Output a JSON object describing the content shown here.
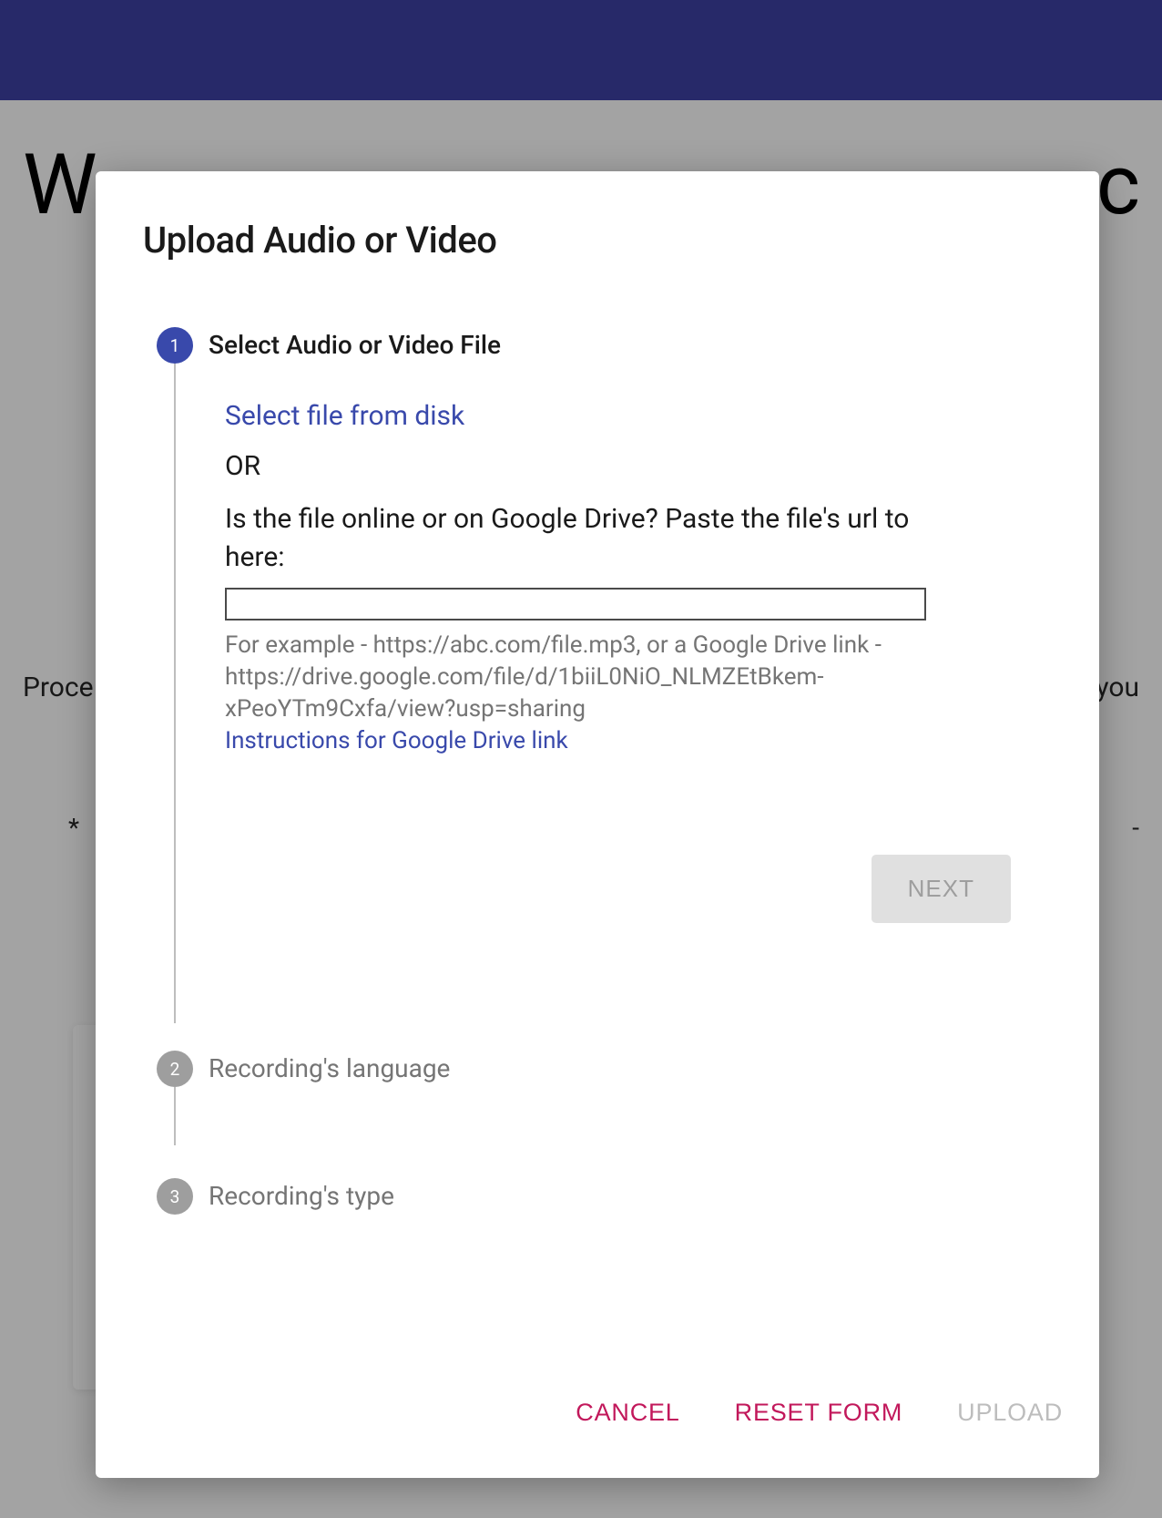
{
  "background": {
    "heading_left": "W",
    "heading_right": "c",
    "text1_left": "Proce",
    "text1_right": "you",
    "text2_left": "*",
    "text2_right": "-"
  },
  "dialog": {
    "title": "Upload Audio or Video",
    "steps": {
      "step1": {
        "number": "1",
        "label": "Select Audio or Video File",
        "select_file_link": "Select file from disk",
        "or_text": "OR",
        "paste_label": "Is the file online or on Google Drive? Paste the file's url to here:",
        "url_value": "",
        "example_text": "For example - https://abc.com/file.mp3, or a Google Drive link - https://drive.google.com/file/d/1biiL0NiO_NLMZEtBkem-xPeoYTm9Cxfa/view?usp=sharing",
        "drive_instructions_link": "Instructions for Google Drive link",
        "next_button": "NEXT"
      },
      "step2": {
        "number": "2",
        "label": "Recording's language"
      },
      "step3": {
        "number": "3",
        "label": "Recording's type"
      }
    },
    "actions": {
      "cancel": "CANCEL",
      "reset": "RESET FORM",
      "upload": "UPLOAD"
    }
  }
}
